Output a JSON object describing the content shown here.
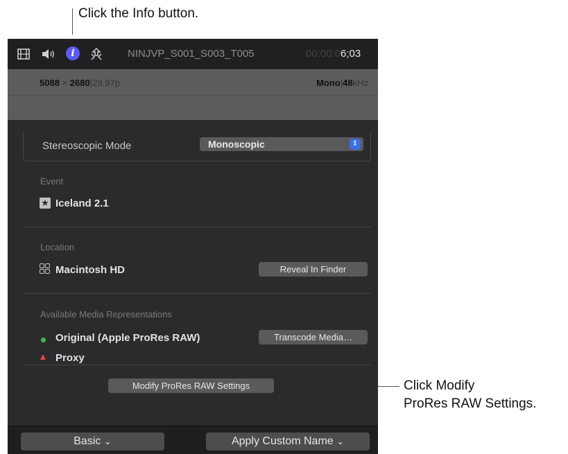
{
  "callouts": {
    "info": "Click the Info button.",
    "modify_line1": "Click Modify",
    "modify_line2": "ProRes RAW Settings."
  },
  "toolbar": {
    "film_icon": "film-icon",
    "audio_icon": "speaker-icon",
    "info_icon": "info-icon",
    "share_icon": "share-icon",
    "info_glyph": "i",
    "clip_name": "NINJVP_S001_S003_T005",
    "timecode_dim": "00:00:0",
    "timecode_bright": "6;03",
    "info_color": "#5b5bf0"
  },
  "meta": {
    "resolution_w": "5088",
    "resolution_x": " × ",
    "resolution_h": "2680",
    "sep": "|",
    "framerate": "29.97p",
    "audio_channels": "Mono",
    "sample_rate_num": "48",
    "sample_rate_unit": "kHz"
  },
  "stereo": {
    "label": "Stereoscopic Mode",
    "selected": "Monoscopic"
  },
  "event": {
    "heading": "Event",
    "name": "Iceland 2.1",
    "icon": "star-icon"
  },
  "location": {
    "heading": "Location",
    "name": "Macintosh HD",
    "icon": "drive-icon",
    "button": "Reveal In Finder"
  },
  "representations": {
    "heading": "Available Media Representations",
    "original": "Original (Apple ProRes RAW)",
    "proxy": "Proxy",
    "transcode_button": "Transcode Media…",
    "original_status_color": "#3fbb52",
    "proxy_status_color": "#e34a3c"
  },
  "modify_button": "Modify ProRes RAW Settings",
  "bottom": {
    "basic": "Basic",
    "apply": "Apply Custom Name",
    "chevron": "⌄"
  }
}
